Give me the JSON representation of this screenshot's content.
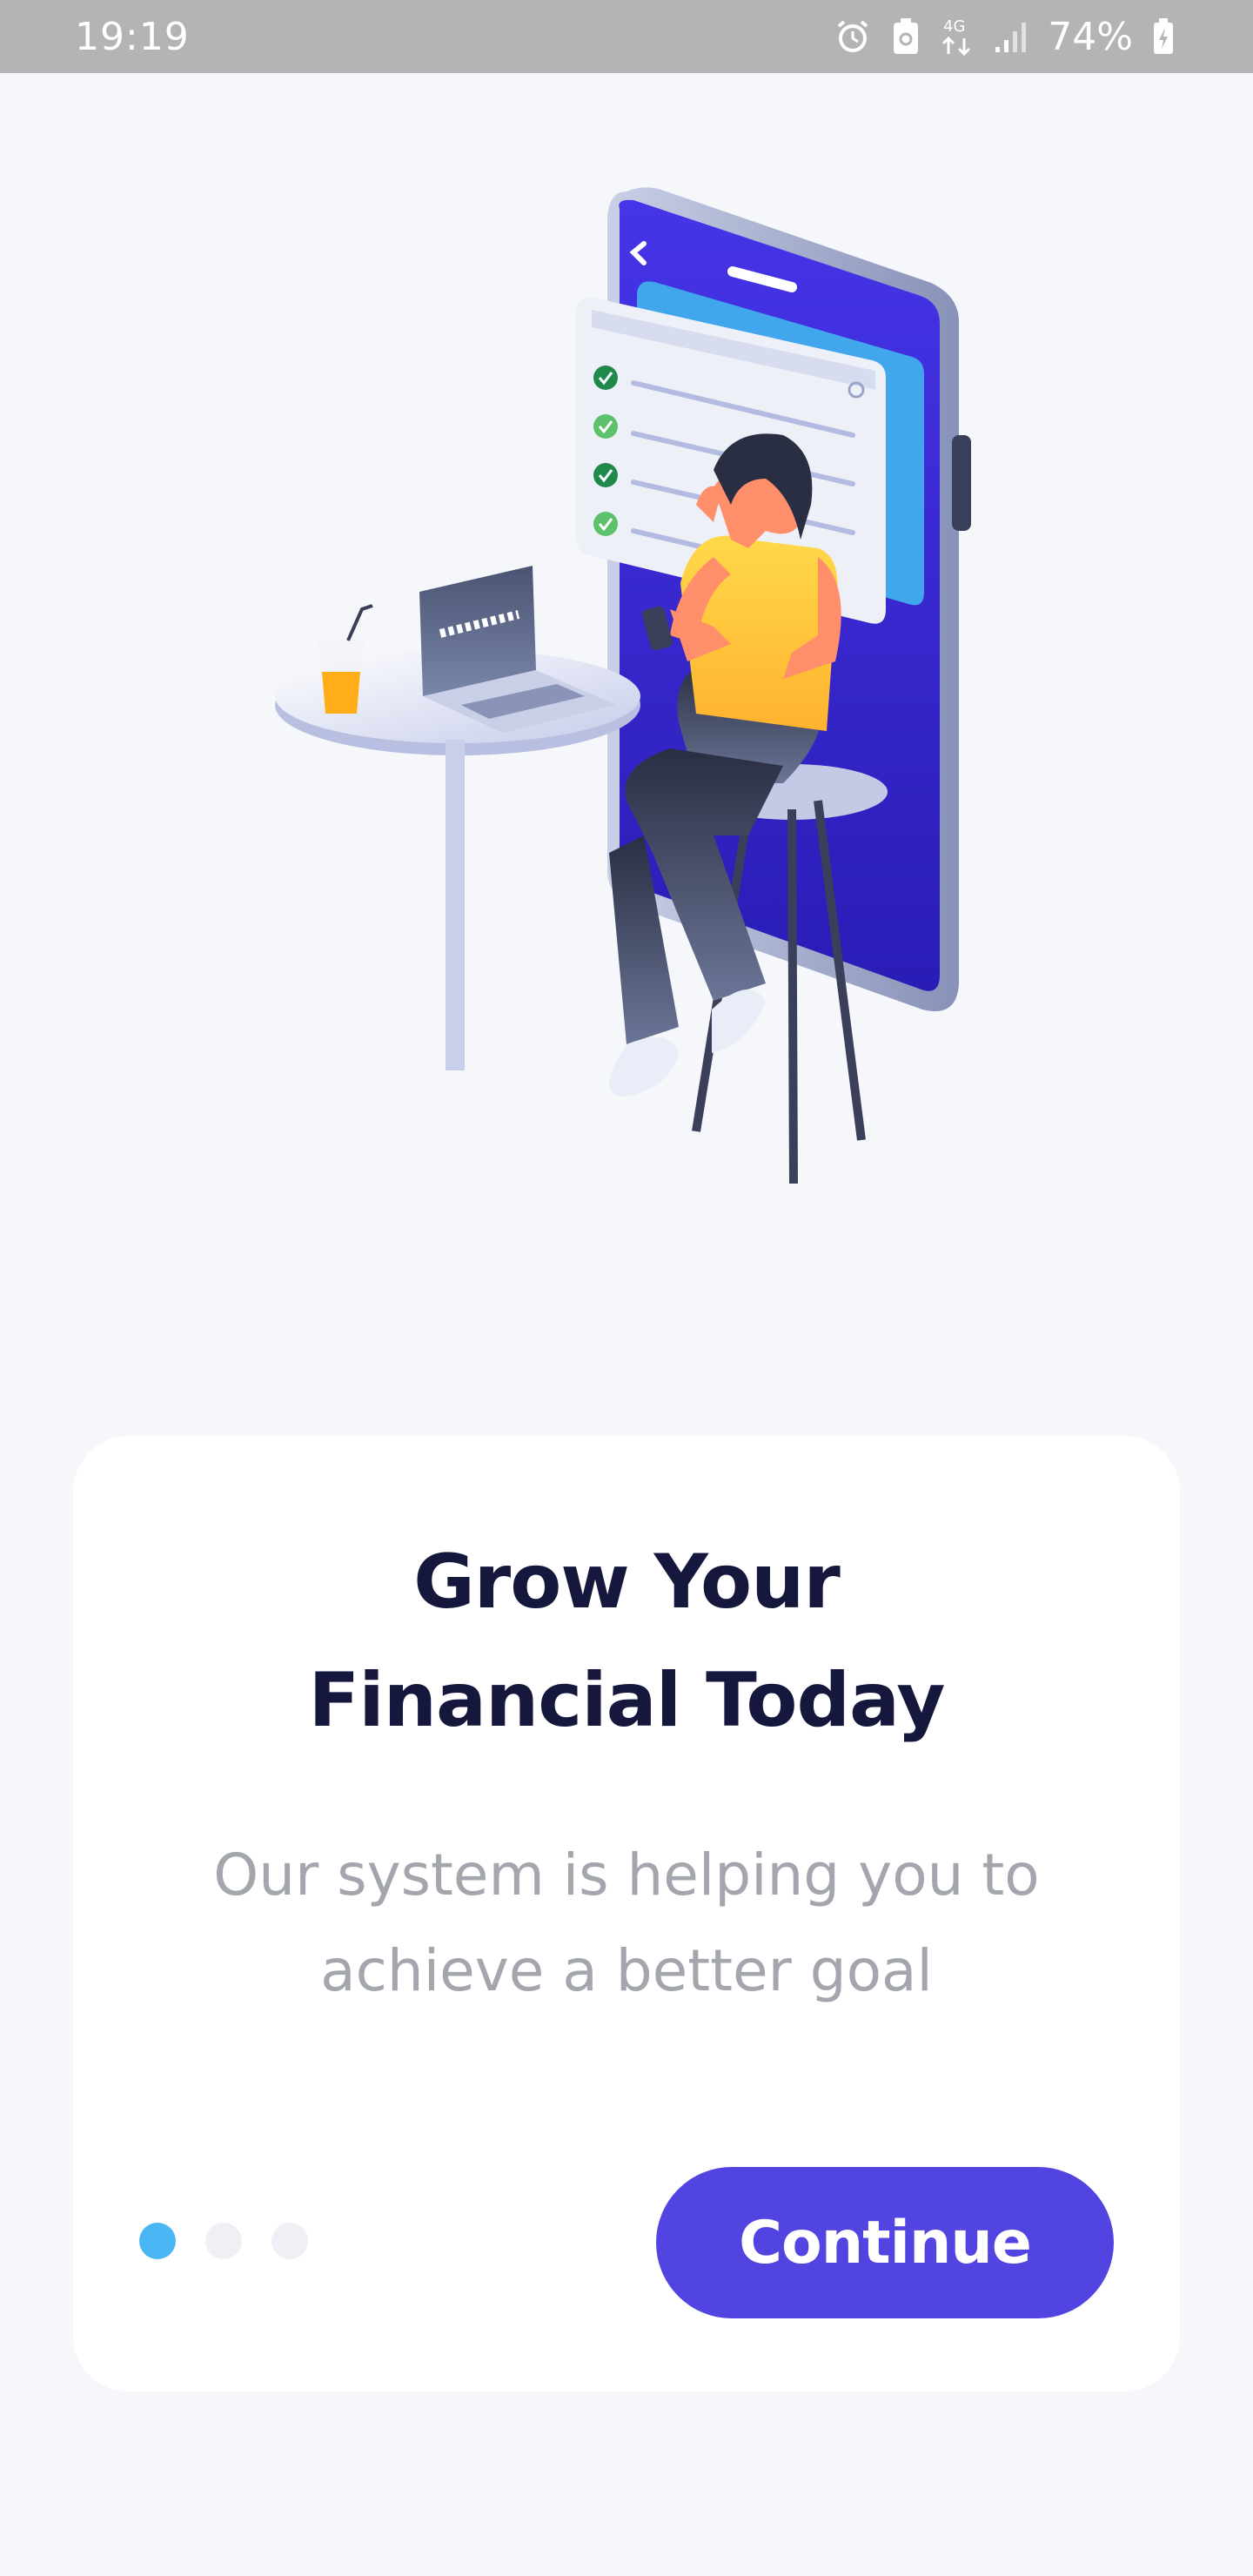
{
  "status_bar": {
    "time": "19:19",
    "battery_percent": "74%",
    "network": "4G",
    "icons": [
      "alarm-icon",
      "battery-saver-icon",
      "4g-icon",
      "signal-icon",
      "battery-charging-icon"
    ]
  },
  "illustration": {
    "subject": "onboarding-illustration-woman-phone"
  },
  "onboarding": {
    "title_line1": "Grow Your",
    "title_line2": "Financial Today",
    "subtitle_line1": "Our system is helping you to",
    "subtitle_line2": "achieve a better goal",
    "continue_label": "Continue",
    "page_count": 3,
    "active_page": 1
  },
  "colors": {
    "primary": "#5244e0",
    "dot_active": "#4ab7f4",
    "dot_inactive": "#eef0f5",
    "title": "#15173d",
    "subtitle": "#a4a6ad",
    "background": "#f5f7fb"
  }
}
